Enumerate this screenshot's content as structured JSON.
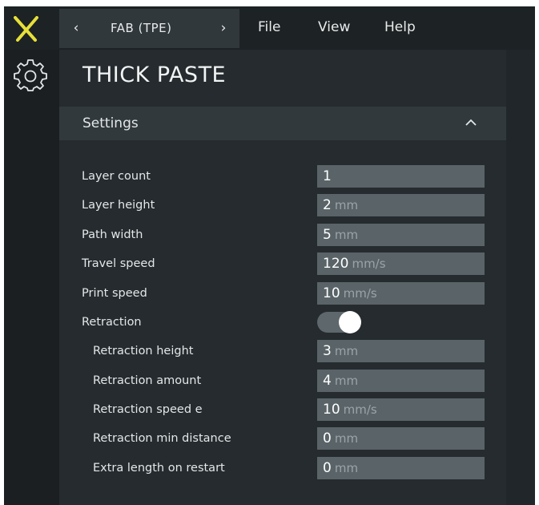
{
  "topbar": {
    "machine_name": "FAB (TPE)",
    "prev_glyph": "‹",
    "next_glyph": "›",
    "menu": [
      "File",
      "View",
      "Help"
    ]
  },
  "icons": {
    "logo": "x-logo-icon",
    "settings": "gear-icon",
    "collapse": "chevron-up-icon"
  },
  "panel": {
    "title": "THICK PASTE",
    "section": "Settings"
  },
  "settings": [
    {
      "label": "Layer count",
      "value": "1",
      "unit": ""
    },
    {
      "label": "Layer height",
      "value": "2",
      "unit": "mm"
    },
    {
      "label": "Path width",
      "value": "5",
      "unit": "mm"
    },
    {
      "label": "Travel speed",
      "value": "120",
      "unit": "mm/s"
    },
    {
      "label": "Print speed",
      "value": "10",
      "unit": "mm/s"
    },
    {
      "label": "Retraction",
      "toggle": true
    },
    {
      "label": "Retraction height",
      "value": "3",
      "unit": "mm"
    },
    {
      "label": "Retraction amount",
      "value": "4",
      "unit": "mm"
    },
    {
      "label": "Retraction speed e",
      "value": "10",
      "unit": "mm/s"
    },
    {
      "label": "Retraction min distance",
      "value": "0",
      "unit": "mm"
    },
    {
      "label": "Extra length on restart",
      "value": "0",
      "unit": "mm"
    }
  ],
  "colors": {
    "accent": "#e6e03a",
    "background": "#252b2e",
    "field": "#5a6468"
  }
}
